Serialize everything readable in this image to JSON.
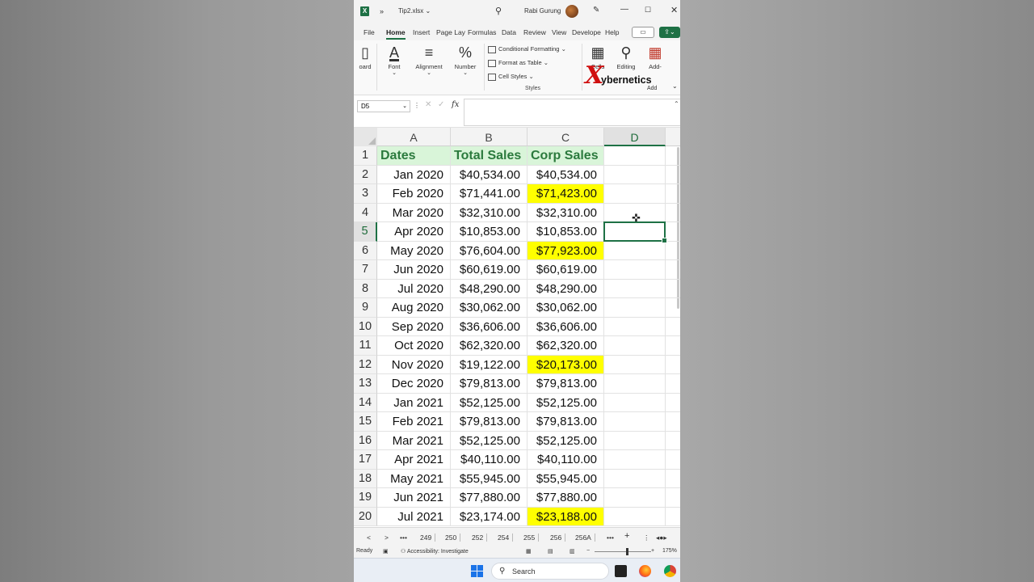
{
  "window": {
    "app_icon": "excel-icon",
    "more_chevron": "»",
    "title": "Tip2.xlsx",
    "title_chevron": "⌄",
    "user_name": "Rabi Gurung",
    "buttons": {
      "minimize": "—",
      "maximize": "☐",
      "close": "✕"
    }
  },
  "ribbon_tabs": [
    "File",
    "Home",
    "Insert",
    "Page Lay",
    "Formulas",
    "Data",
    "Review",
    "View",
    "Develope",
    "Help"
  ],
  "active_tab": "Home",
  "ribbon": {
    "clipboard_label": "oard",
    "font": {
      "label": "Font",
      "glyph": "A"
    },
    "alignment": {
      "label": "Alignment",
      "glyph": "≡"
    },
    "number": {
      "label": "Number",
      "glyph": "%"
    },
    "styles": {
      "conditional_formatting": "Conditional Formatting",
      "format_as_table": "Format as Table",
      "cell_styles": "Cell Styles",
      "caption": "Styles"
    },
    "cells": {
      "label": "Cells"
    },
    "editing": {
      "label": "Editing"
    },
    "addins": {
      "label": "Add-",
      "caption": "Add"
    },
    "dropdown_glyph": "⌄"
  },
  "watermark": {
    "mark": "X",
    "text": "ybernetics"
  },
  "formula_bar": {
    "name_box": "D5",
    "fx": "fx",
    "value": ""
  },
  "columns": [
    "A",
    "B",
    "C",
    "D"
  ],
  "selected_column": "D",
  "selected_row": 5,
  "header_row": [
    "Dates",
    "Total Sales",
    "Corp Sales",
    ""
  ],
  "rows": [
    {
      "n": 2,
      "date": "Jan 2020",
      "total": "$40,534.00",
      "corp": "$40,534.00",
      "highlight": false
    },
    {
      "n": 3,
      "date": "Feb 2020",
      "total": "$71,441.00",
      "corp": "$71,423.00",
      "highlight": true
    },
    {
      "n": 4,
      "date": "Mar 2020",
      "total": "$32,310.00",
      "corp": "$32,310.00",
      "highlight": false
    },
    {
      "n": 5,
      "date": "Apr 2020",
      "total": "$10,853.00",
      "corp": "$10,853.00",
      "highlight": false
    },
    {
      "n": 6,
      "date": "May 2020",
      "total": "$76,604.00",
      "corp": "$77,923.00",
      "highlight": true
    },
    {
      "n": 7,
      "date": "Jun 2020",
      "total": "$60,619.00",
      "corp": "$60,619.00",
      "highlight": false
    },
    {
      "n": 8,
      "date": "Jul 2020",
      "total": "$48,290.00",
      "corp": "$48,290.00",
      "highlight": false
    },
    {
      "n": 9,
      "date": "Aug 2020",
      "total": "$30,062.00",
      "corp": "$30,062.00",
      "highlight": false
    },
    {
      "n": 10,
      "date": "Sep 2020",
      "total": "$36,606.00",
      "corp": "$36,606.00",
      "highlight": false
    },
    {
      "n": 11,
      "date": "Oct 2020",
      "total": "$62,320.00",
      "corp": "$62,320.00",
      "highlight": false
    },
    {
      "n": 12,
      "date": "Nov 2020",
      "total": "$19,122.00",
      "corp": "$20,173.00",
      "highlight": true
    },
    {
      "n": 13,
      "date": "Dec 2020",
      "total": "$79,813.00",
      "corp": "$79,813.00",
      "highlight": false
    },
    {
      "n": 14,
      "date": "Jan 2021",
      "total": "$52,125.00",
      "corp": "$52,125.00",
      "highlight": false
    },
    {
      "n": 15,
      "date": "Feb 2021",
      "total": "$79,813.00",
      "corp": "$79,813.00",
      "highlight": false
    },
    {
      "n": 16,
      "date": "Mar 2021",
      "total": "$52,125.00",
      "corp": "$52,125.00",
      "highlight": false
    },
    {
      "n": 17,
      "date": "Apr 2021",
      "total": "$40,110.00",
      "corp": "$40,110.00",
      "highlight": false
    },
    {
      "n": 18,
      "date": "May 2021",
      "total": "$55,945.00",
      "corp": "$55,945.00",
      "highlight": false
    },
    {
      "n": 19,
      "date": "Jun 2021",
      "total": "$77,880.00",
      "corp": "$77,880.00",
      "highlight": false
    },
    {
      "n": 20,
      "date": "Jul 2021",
      "total": "$23,174.00",
      "corp": "$23,188.00",
      "highlight": true
    }
  ],
  "sheet_tabs": [
    "249",
    "250",
    "252",
    "254",
    "255",
    "256",
    "256A"
  ],
  "sheet_nav": {
    "prev": "<",
    "next": ">",
    "more": "•••",
    "add": "+",
    "options": "⋮"
  },
  "status": {
    "mode": "Ready",
    "accessibility": "Accessibility: Investigate",
    "zoom": "175%",
    "zoom_level_percent": 175
  },
  "taskbar": {
    "search_placeholder": "Search"
  },
  "colors": {
    "excel_green": "#1e7145",
    "highlight_yellow": "#ffff00",
    "header_fill": "#d9f5d9",
    "header_text": "#2b7a3d"
  }
}
